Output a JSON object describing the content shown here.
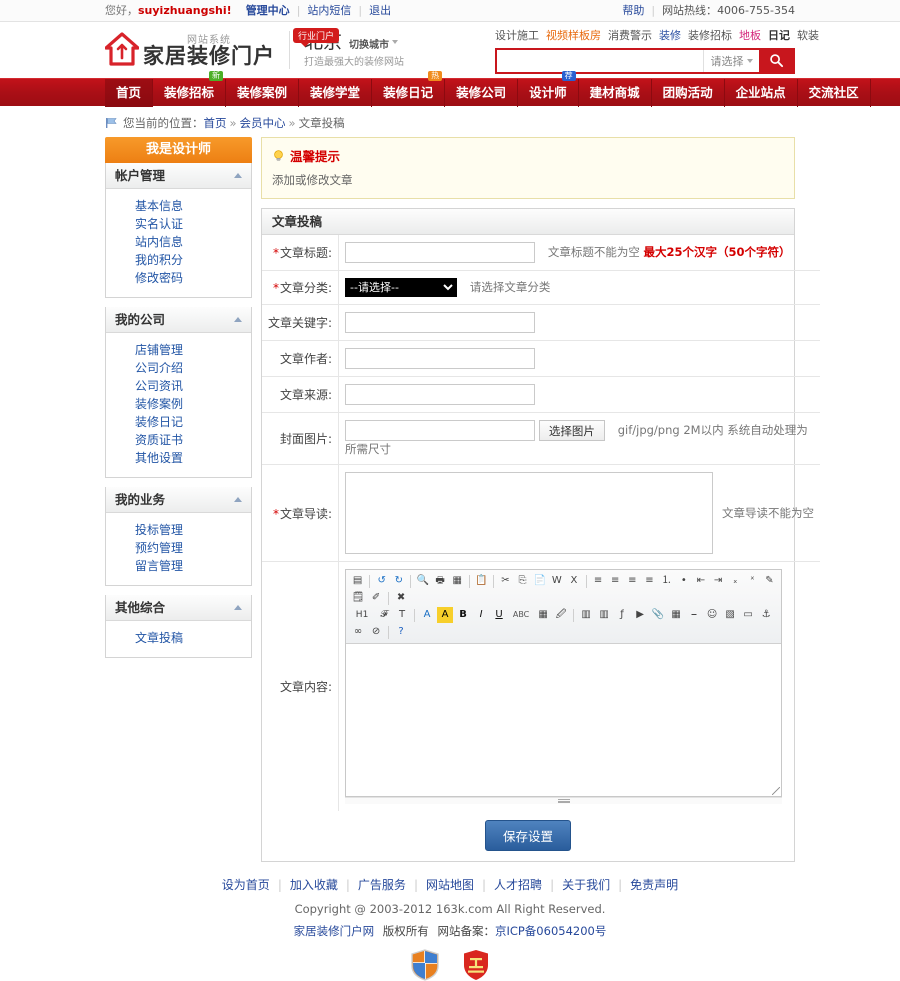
{
  "topbar": {
    "greeting": "您好，",
    "username": "suyizhuangshi!",
    "links": [
      "管理中心",
      "站内短信",
      "退出"
    ],
    "help": "帮助",
    "hotline_label": "网站热线：",
    "hotline_number": "4006-755-354"
  },
  "header": {
    "logo_sub": "网站系统",
    "logo_main": "家居装修门户",
    "logo_badge": "行业门户",
    "city": "北京",
    "city_switch": "切换城市",
    "slogan": "打造最强大的装修网站",
    "hotwords": [
      {
        "text": "设计施工",
        "color": "plain"
      },
      {
        "text": "视频样板房",
        "color": "orange"
      },
      {
        "text": "消费警示",
        "color": "plain"
      },
      {
        "text": "装修",
        "color": "blue"
      },
      {
        "text": "装修招标",
        "color": "plain"
      },
      {
        "text": "地板",
        "color": "pink"
      },
      {
        "text": "日记",
        "color": "bold"
      },
      {
        "text": "软装",
        "color": "plain"
      }
    ],
    "search_value": "",
    "search_placeholder": "",
    "search_select": "请选择",
    "search_icon": "search-icon"
  },
  "nav": [
    {
      "label": "首页",
      "badge": null
    },
    {
      "label": "装修招标",
      "badge": "新",
      "badge_color": "green"
    },
    {
      "label": "装修案例",
      "badge": null
    },
    {
      "label": "装修学堂",
      "badge": null
    },
    {
      "label": "装修日记",
      "badge": "热",
      "badge_color": "orange"
    },
    {
      "label": "装修公司",
      "badge": null
    },
    {
      "label": "设计师",
      "badge": "荐",
      "badge_color": "blue"
    },
    {
      "label": "建材商城",
      "badge": null
    },
    {
      "label": "团购活动",
      "badge": null
    },
    {
      "label": "企业站点",
      "badge": null
    },
    {
      "label": "交流社区",
      "badge": null
    }
  ],
  "breadcrumb": {
    "prefix": "您当前的位置：",
    "items": [
      "首页",
      "会员中心",
      "文章投稿"
    ],
    "separator": "»"
  },
  "sidebar": {
    "title": "我是设计师",
    "groups": [
      {
        "title": "帐户管理",
        "items": [
          "基本信息",
          "实名认证",
          "站内信息",
          "我的积分",
          "修改密码"
        ]
      },
      {
        "title": "我的公司",
        "items": [
          "店铺管理",
          "公司介绍",
          "公司资讯",
          "装修案例",
          "装修日记",
          "资质证书",
          "其他设置"
        ]
      },
      {
        "title": "我的业务",
        "items": [
          "投标管理",
          "预约管理",
          "留言管理"
        ]
      },
      {
        "title": "其他综合",
        "items": [
          "文章投稿"
        ]
      }
    ]
  },
  "tip": {
    "icon": "lightbulb-icon",
    "title": "温馨提示",
    "body": "添加或修改文章"
  },
  "panel": {
    "title": "文章投稿",
    "fields": [
      {
        "label": "文章标题:",
        "required": true,
        "type": "text",
        "value": "",
        "hint": "文章标题不能为空",
        "hint_red": "最大25个汉字（50个字符）"
      },
      {
        "label": "文章分类:",
        "required": true,
        "type": "select",
        "value": "--请选择--",
        "hint": "请选择文章分类",
        "hint_red": ""
      },
      {
        "label": "文章关键字:",
        "required": false,
        "type": "text",
        "value": "",
        "hint": "",
        "hint_red": ""
      },
      {
        "label": "文章作者:",
        "required": false,
        "type": "text",
        "value": "",
        "hint": "",
        "hint_red": ""
      },
      {
        "label": "文章来源:",
        "required": false,
        "type": "text",
        "value": "",
        "hint": "",
        "hint_red": ""
      },
      {
        "label": "封面图片:",
        "required": false,
        "type": "file",
        "value": "",
        "button": "选择图片",
        "hint": "gif/jpg/png 2M以内 系统自动处理为所需尺寸",
        "hint_red": ""
      },
      {
        "label": "文章导读:",
        "required": true,
        "type": "textarea",
        "value": "",
        "hint": "文章导读不能为空",
        "hint_red": ""
      },
      {
        "label": "文章内容:",
        "required": false,
        "type": "editor",
        "value": "",
        "hint": "",
        "hint_red": ""
      }
    ],
    "submit": "保存设置"
  },
  "editor": {
    "rows": [
      [
        "source-icon",
        "sep",
        "undo-icon",
        "redo-icon",
        "sep",
        "preview-icon",
        "print-icon",
        "templates-icon",
        "sep",
        "paste-icon",
        "sep",
        "cut-icon",
        "copy-icon",
        "paste-plain-icon",
        "paste-word-icon",
        "paste-excel-icon",
        "sep",
        "align-left-icon",
        "align-center-icon",
        "align-right-icon",
        "align-justify-icon",
        "numbered-list-icon",
        "bulleted-list-icon",
        "outdent-icon",
        "indent-icon",
        "subscript-icon",
        "superscript-icon",
        "select-all-icon"
      ],
      [
        "spellcheck-icon",
        "eraser-icon",
        "sep",
        "remove-format-icon"
      ],
      [
        "heading-icon",
        "font-icon",
        "font-size-icon",
        "sep",
        "text-color-icon",
        "bg-color-icon",
        "bold-icon",
        "italic-icon",
        "underline-icon",
        "strikethrough-icon",
        "table-grid-icon",
        "clear-style-icon",
        "sep",
        "image-icon",
        "image-multi-icon",
        "flash-icon",
        "video-icon",
        "attachment-icon",
        "table-icon",
        "page-break-icon",
        "emoticon-icon",
        "map-icon",
        "form-icon",
        "anchor-icon"
      ],
      [
        "link-icon",
        "unlink-icon",
        "sep",
        "about-icon"
      ]
    ]
  },
  "footer": {
    "links": [
      "设为首页",
      "加入收藏",
      "广告服务",
      "网站地图",
      "人才招聘",
      "关于我们",
      "免责声明"
    ],
    "copyright": "Copyright @ 2003-2012 163k.com All Right Reserved.",
    "site_name": "家居装修门户网",
    "rights": "版权所有",
    "record_label": "网站备案：",
    "record_number": "京ICP备06054200号",
    "badge_shield": "police-shield-badge",
    "badge_seal": "trust-seal-badge"
  }
}
